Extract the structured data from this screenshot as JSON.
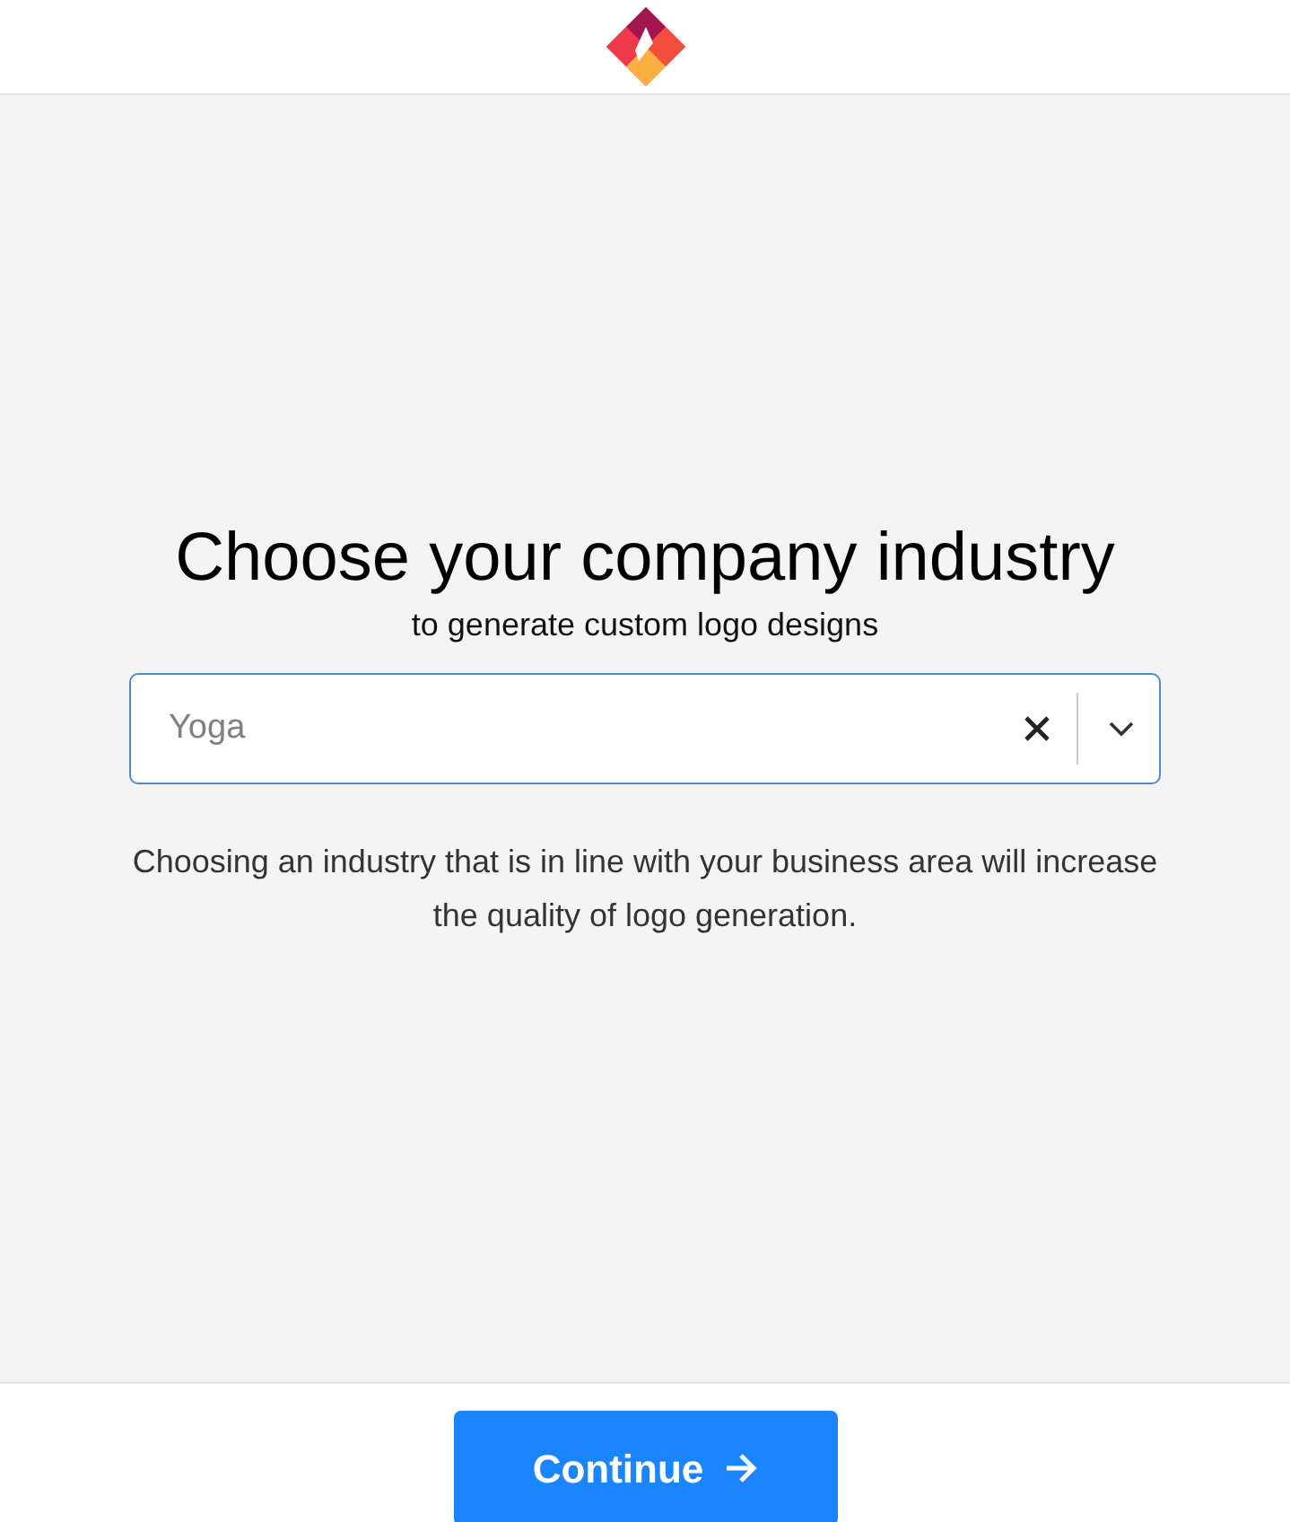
{
  "heading": "Choose your company industry",
  "subheading": "to generate custom logo designs",
  "industry_field": {
    "value": "Yoga"
  },
  "hint": "Choosing an industry that is in line with your business area will increase the quality of logo generation.",
  "continue_button": {
    "label": "Continue"
  }
}
